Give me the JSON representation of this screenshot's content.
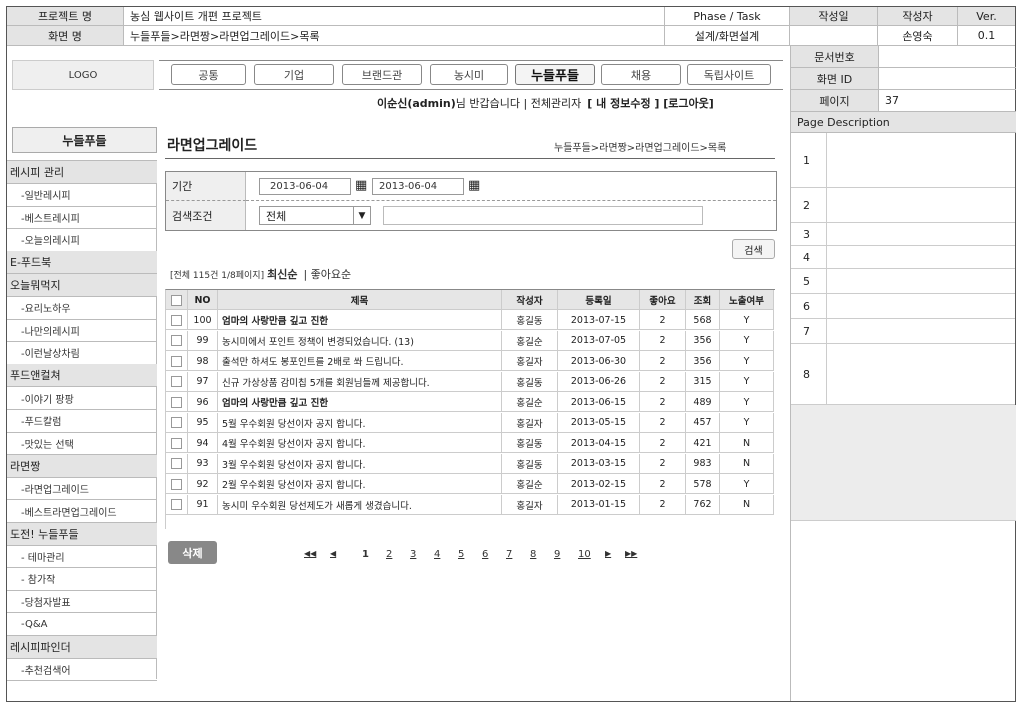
{
  "header": {
    "project_label": "프로젝트 명",
    "project_value": "농심 웹사이트 개편 프로젝트",
    "screen_label": "화면 명",
    "screen_value": "누들푸들>라면짱>라면업그레이드>목록",
    "phase_label": "Phase / Task",
    "phase_value": "설계/화면설계",
    "date_label": "작성일",
    "date_value": "",
    "author_label": "작성자",
    "author_value": "손영숙",
    "ver_label": "Ver.",
    "ver_value": "0.1"
  },
  "meta": {
    "doc_no_label": "문서번호",
    "screen_id_label": "화면 ID",
    "page_label": "페이지",
    "page_value": "37",
    "page_desc_label": "Page Description",
    "desc_numbers": [
      "1",
      "2",
      "3",
      "4",
      "5",
      "6",
      "7",
      "8"
    ]
  },
  "logo": "LOGO",
  "top_nav": [
    "공통",
    "기업",
    "브랜드관",
    "농시미",
    "누들푸들",
    "채용",
    "독립사이트"
  ],
  "user_bar": {
    "user": "이순신(admin)",
    "greeting": "님 반갑습니다 | 전체관리자",
    "links": "[ 내 정보수정 ] [로그아웃]"
  },
  "sidebar": {
    "title": "누들푸들",
    "items": [
      {
        "label": "레시피 관리",
        "group": true
      },
      {
        "label": "-일반레시피",
        "group": false
      },
      {
        "label": "-베스트레시피",
        "group": false
      },
      {
        "label": "-오늘의레시피",
        "group": false
      },
      {
        "label": "E-푸드북",
        "group": true
      },
      {
        "label": "오늘뭐먹지",
        "group": true
      },
      {
        "label": "-요리노하우",
        "group": false
      },
      {
        "label": "-나만의레시피",
        "group": false
      },
      {
        "label": "-이런날상차림",
        "group": false
      },
      {
        "label": "푸드앤컬쳐",
        "group": true
      },
      {
        "label": "-이야기 팡팡",
        "group": false
      },
      {
        "label": "-푸드칼럼",
        "group": false
      },
      {
        "label": "-맛있는 선택",
        "group": false
      },
      {
        "label": "라면짱",
        "group": true
      },
      {
        "label": "-라면업그레이드",
        "group": false
      },
      {
        "label": "-베스트라면업그레이드",
        "group": false
      },
      {
        "label": "도전! 누들푸들",
        "group": true
      },
      {
        "label": "- 테마관리",
        "group": false
      },
      {
        "label": "- 참가작",
        "group": false
      },
      {
        "label": "-당첨자발표",
        "group": false
      },
      {
        "label": "-Q&A",
        "group": false
      },
      {
        "label": "레시피파인더",
        "group": true
      },
      {
        "label": "-추천검색어",
        "group": false
      }
    ]
  },
  "main": {
    "title": "라면업그레이드",
    "breadcrumb": "누들푸들>라면짱>라면업그레이드>목록",
    "filter": {
      "period_label": "기간",
      "date_from": "2013-06-04",
      "date_to": "2013-06-04",
      "condition_label": "검색조건",
      "condition_value": "전체",
      "keyword": "",
      "search_button": "검색"
    },
    "summary": "[전체 115건 1/8페이지]",
    "sort_latest": "최신순",
    "sort_likes": "| 좋아요순",
    "columns": [
      "",
      "NO",
      "제목",
      "작성자",
      "등록일",
      "좋아요",
      "조회",
      "노출여부"
    ],
    "rows": [
      {
        "no": "100",
        "title": "엄마의 사랑만큼 깊고 진한",
        "bold": true,
        "author": "홍길동",
        "date": "2013-07-15",
        "likes": "2",
        "views": "568",
        "visible": "Y"
      },
      {
        "no": "99",
        "title": "농시미에서 포인트 정책이 변경되었습니다. (13)",
        "bold": false,
        "author": "홍길순",
        "date": "2013-07-05",
        "likes": "2",
        "views": "356",
        "visible": "Y"
      },
      {
        "no": "98",
        "title": "출석만 하셔도 봉포인트를 2배로 쏴 드립니다.",
        "bold": false,
        "author": "홍길자",
        "date": "2013-06-30",
        "likes": "2",
        "views": "356",
        "visible": "Y"
      },
      {
        "no": "97",
        "title": "신규 가상상품 감미칩 5개를 회원님들께 제공합니다.",
        "bold": false,
        "author": "홍길동",
        "date": "2013-06-26",
        "likes": "2",
        "views": "315",
        "visible": "Y"
      },
      {
        "no": "96",
        "title": "엄마의 사랑만큼 깊고 진한",
        "bold": true,
        "author": "홍길순",
        "date": "2013-06-15",
        "likes": "2",
        "views": "489",
        "visible": "Y"
      },
      {
        "no": "95",
        "title": "5월 우수회원 당선이자 공지 합니다.",
        "bold": false,
        "author": "홍길자",
        "date": "2013-05-15",
        "likes": "2",
        "views": "457",
        "visible": "Y"
      },
      {
        "no": "94",
        "title": "4월 우수회원 당선이자 공지 합니다.",
        "bold": false,
        "author": "홍길동",
        "date": "2013-04-15",
        "likes": "2",
        "views": "421",
        "visible": "N"
      },
      {
        "no": "93",
        "title": "3월 우수회원 당선이자 공지 합니다.",
        "bold": false,
        "author": "홍길동",
        "date": "2013-03-15",
        "likes": "2",
        "views": "983",
        "visible": "N"
      },
      {
        "no": "92",
        "title": "2월 우수회원 당선이자 공지 합니다.",
        "bold": false,
        "author": "홍길순",
        "date": "2013-02-15",
        "likes": "2",
        "views": "578",
        "visible": "Y"
      },
      {
        "no": "91",
        "title": "농시미 우수회원 당선제도가 새롭게 생겼습니다.",
        "bold": false,
        "author": "홍길자",
        "date": "2013-01-15",
        "likes": "2",
        "views": "762",
        "visible": "N"
      }
    ],
    "delete_button": "삭제",
    "pagination": {
      "first": "◀◀",
      "prev": "◀",
      "pages": [
        "1",
        "2",
        "3",
        "4",
        "5",
        "6",
        "7",
        "8",
        "9",
        "10"
      ],
      "current": "1",
      "next": "▶",
      "last": "▶▶"
    }
  }
}
